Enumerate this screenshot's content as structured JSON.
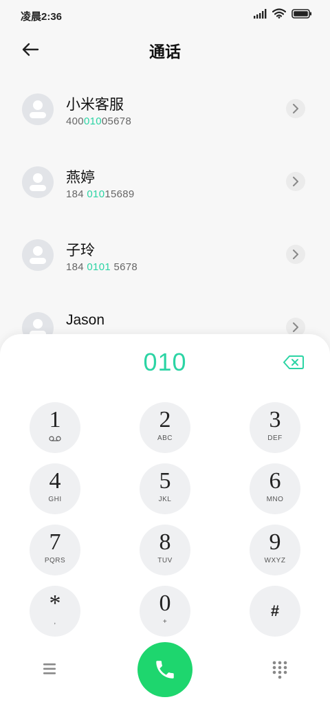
{
  "status_bar": {
    "time": "凌晨2:36",
    "icons": [
      "signal-icon",
      "wifi-icon",
      "battery-icon"
    ]
  },
  "header": {
    "title": "通话",
    "back_icon": "back-arrow-icon"
  },
  "contacts": [
    {
      "name": "小米客服",
      "number_parts": [
        "400",
        "010",
        "05678"
      ]
    },
    {
      "name": "燕婷",
      "number_parts": [
        "184 ",
        "010",
        "15689"
      ]
    },
    {
      "name": "子玲",
      "number_parts": [
        "184 ",
        "0101",
        " 5678"
      ]
    },
    {
      "name": "Jason",
      "number_parts": [
        "",
        "",
        ""
      ]
    }
  ],
  "dialer": {
    "input": "010",
    "keys": [
      {
        "digit": "1",
        "letters": ""
      },
      {
        "digit": "2",
        "letters": "ABC"
      },
      {
        "digit": "3",
        "letters": "DEF"
      },
      {
        "digit": "4",
        "letters": "GHI"
      },
      {
        "digit": "5",
        "letters": "JKL"
      },
      {
        "digit": "6",
        "letters": "MNO"
      },
      {
        "digit": "7",
        "letters": "PQRS"
      },
      {
        "digit": "8",
        "letters": "TUV"
      },
      {
        "digit": "9",
        "letters": "WXYZ"
      },
      {
        "digit": "*",
        "letters": ","
      },
      {
        "digit": "0",
        "letters": "+"
      },
      {
        "digit": "#",
        "letters": ""
      }
    ]
  },
  "colors": {
    "accent": "#2bd4a4",
    "call_button": "#1ed66e",
    "key_background": "#eff0f2"
  }
}
